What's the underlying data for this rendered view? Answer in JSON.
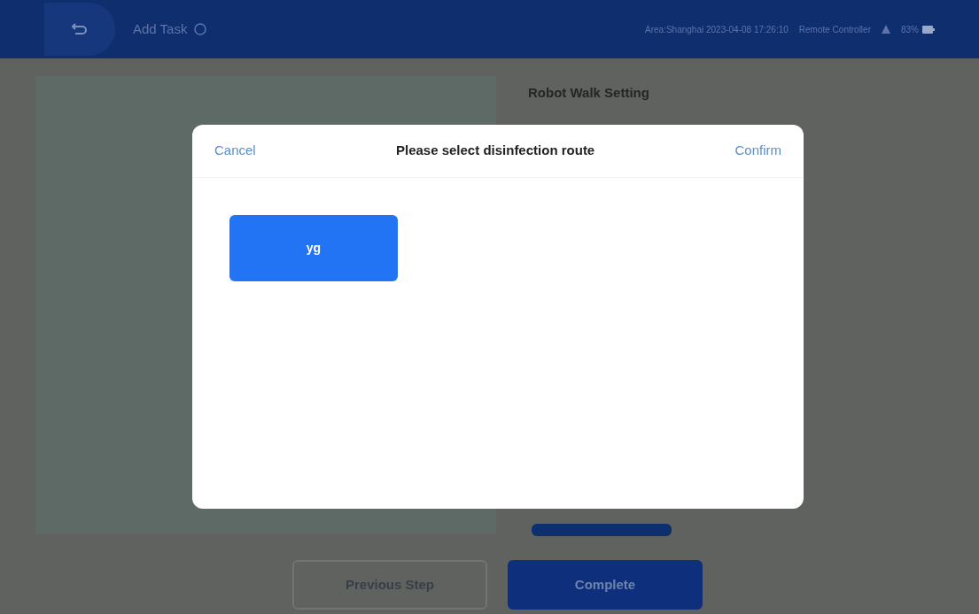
{
  "header": {
    "title": "Add Task",
    "status": "Area:Shanghai 2023-04-08 17:26:10",
    "controller": "Remote Controller",
    "battery": "83%"
  },
  "settings_panel": {
    "title": "Robot Walk Setting"
  },
  "dialog": {
    "cancel": "Cancel",
    "title": "Please select disinfection route",
    "confirm": "Confirm",
    "routes": [
      {
        "label": "yg",
        "selected": true
      }
    ]
  },
  "footer": {
    "buttons": [
      {
        "kind": "outline",
        "label": "Previous Step"
      },
      {
        "kind": "primary",
        "label": "Complete"
      }
    ]
  }
}
